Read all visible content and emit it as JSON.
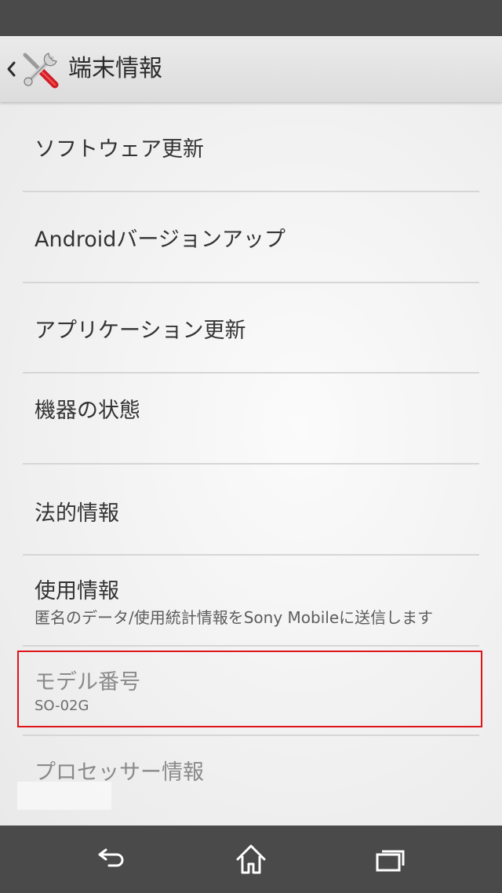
{
  "header": {
    "title": "端末情報",
    "app_icon": "tools-icon"
  },
  "items": [
    {
      "title": "ソフトウェア更新"
    },
    {
      "title": "Androidバージョンアップ"
    },
    {
      "title": "アプリケーション更新"
    },
    {
      "title": "機器の状態"
    },
    {
      "title": "法的情報"
    },
    {
      "title": "使用情報",
      "subtitle": "匿名のデータ/使用統計情報をSony Mobileに送信します"
    },
    {
      "title": "モデル番号",
      "subtitle": "SO-02G",
      "highlighted": true
    },
    {
      "title": "プロセッサー情報"
    }
  ],
  "navigation": {
    "buttons": [
      "back-icon",
      "home-icon",
      "recent-apps-icon"
    ]
  },
  "colors": {
    "highlight": "#e0141b",
    "status_bar": "#4a4a4a",
    "nav_bar": "#4a4a4a"
  }
}
